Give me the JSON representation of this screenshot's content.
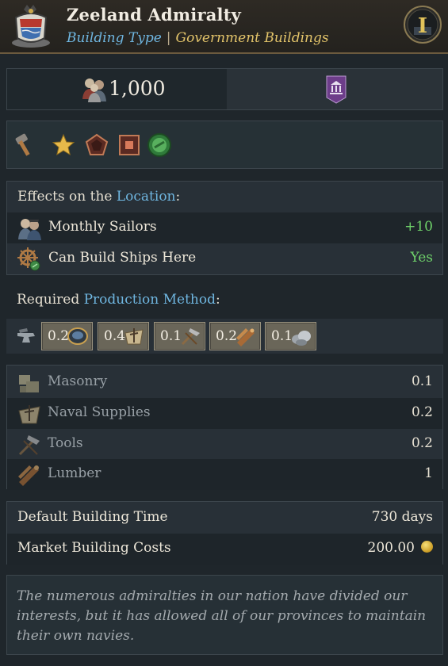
{
  "header": {
    "title": "Zeeland Admiralty",
    "building_type_label": "Building Type",
    "separator": "|",
    "building_group": "Government Buildings",
    "tier": "I"
  },
  "cost": {
    "population": "1,000"
  },
  "effects": {
    "heading_prefix": "Effects on the ",
    "heading_link": "Location",
    "heading_suffix": ":",
    "rows": [
      {
        "label": "Monthly Sailors",
        "value": "+10",
        "icon": "sailors-icon"
      },
      {
        "label": "Can Build Ships Here",
        "value": "Yes",
        "icon": "ship-wheel-icon"
      }
    ]
  },
  "production": {
    "heading_prefix": "Required ",
    "heading_link": "Production Method",
    "heading_suffix": ":",
    "chips": [
      {
        "amount": "0.2",
        "icon": "bowl-icon"
      },
      {
        "amount": "0.4",
        "icon": "naval-supplies-icon"
      },
      {
        "amount": "0.1",
        "icon": "tools-icon"
      },
      {
        "amount": "0.2",
        "icon": "lumber-icon"
      },
      {
        "amount": "0.1",
        "icon": "stone-icon"
      }
    ]
  },
  "inputs": [
    {
      "label": "Masonry",
      "value": "0.1",
      "icon": "masonry-icon"
    },
    {
      "label": "Naval Supplies",
      "value": "0.2",
      "icon": "naval-supplies-icon"
    },
    {
      "label": "Tools",
      "value": "0.2",
      "icon": "tools-icon"
    },
    {
      "label": "Lumber",
      "value": "1",
      "icon": "lumber-icon"
    }
  ],
  "timecost": {
    "time_label": "Default Building Time",
    "time_value": "730 days",
    "cost_label": "Market Building Costs",
    "cost_value": "200.00"
  },
  "flavor": "The numerous admiralties in our nation have divided our interests, but it has allowed all of our provinces to maintain their own navies.",
  "colors": {
    "link_blue": "#6fb6e0",
    "gold": "#e3c46a",
    "positive_green": "#6fd26a"
  }
}
